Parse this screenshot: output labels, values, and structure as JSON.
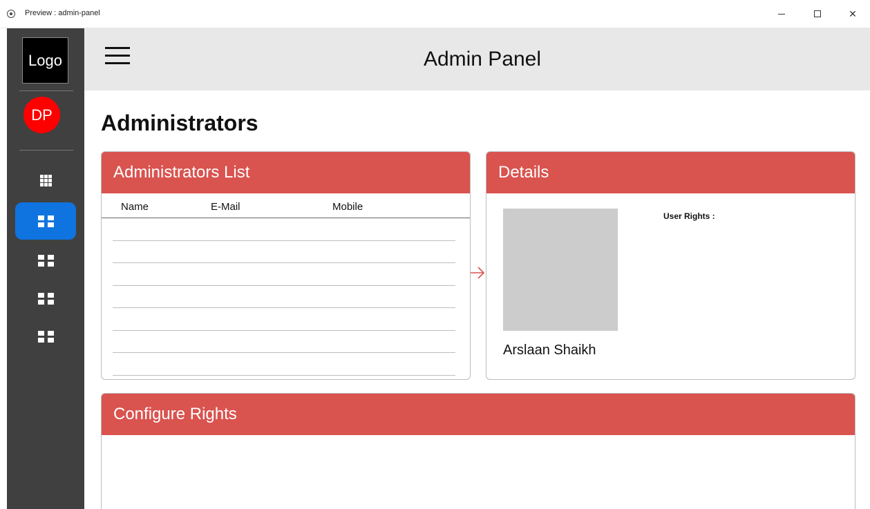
{
  "window": {
    "title": "Preview : admin-panel"
  },
  "sidebar": {
    "logo_text": "Logo",
    "avatar_initials": "DP",
    "avatar_color": "#ff0000",
    "items": [
      {
        "icon": "apps-grid-icon",
        "active": false
      },
      {
        "icon": "dashboard-grid-icon",
        "active": true
      },
      {
        "icon": "dashboard-grid-icon",
        "active": false
      },
      {
        "icon": "dashboard-grid-icon",
        "active": false
      },
      {
        "icon": "dashboard-grid-icon",
        "active": false
      }
    ],
    "active_color": "#0f74e0"
  },
  "header": {
    "title": "Admin Panel",
    "menu_icon": "hamburger-menu-icon"
  },
  "main": {
    "page_title": "Administrators",
    "accent_color": "#d9534f",
    "admins_list": {
      "title": "Administrators List",
      "columns": [
        "Name",
        "E-Mail",
        "Mobile"
      ],
      "rows": []
    },
    "details": {
      "title": "Details",
      "user_name": "Arslaan Shaikh",
      "user_rights_label": "User Rights :"
    },
    "configure_rights": {
      "title": "Configure Rights"
    }
  }
}
